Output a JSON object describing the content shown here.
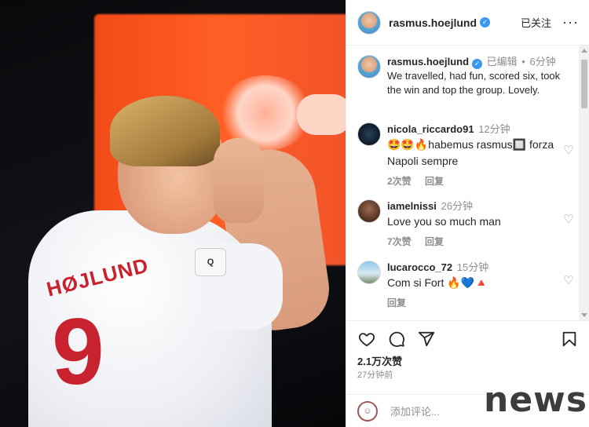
{
  "header": {
    "username": "rasmus.hoejlund",
    "follow_label": "已关注",
    "more_label": "···"
  },
  "post": {
    "username": "rasmus.hoejlund",
    "edited": "已编辑",
    "separator": "•",
    "time": "6分钟",
    "caption": "We travelled, had fun, scored six, took the win and top the group. Lovely."
  },
  "comments": [
    {
      "user": "nicola_riccardo91",
      "time": "12分钟",
      "text": "🤩🤩🔥habemus rasmus🔲 forza Napoli sempre",
      "likes": "2次赞",
      "reply": "回复"
    },
    {
      "user": "iamelnissi",
      "time": "26分钟",
      "text": "Love you so much man",
      "likes": "7次赞",
      "reply": "回复"
    },
    {
      "user": "lucarocco_72",
      "time": "15分钟",
      "text": "Com si Fort 🔥💙🔺",
      "likes": "",
      "reply": "回复"
    }
  ],
  "stats": {
    "likes": "2.1万次赞",
    "posted": "27分钟前"
  },
  "add_comment": {
    "placeholder": "添加评论..."
  },
  "photo": {
    "jersey_number": "9",
    "jersey_name": "HØJLUND",
    "badge": "Q"
  },
  "watermark": "news",
  "icons": {
    "like": "heart-icon",
    "comment": "comment-icon",
    "share": "send-icon",
    "save": "bookmark-icon",
    "verified": "verified-badge-icon",
    "emoji": "emoji-icon"
  },
  "colors": {
    "verified": "#3897f0",
    "muted_text": "#8e8e8e",
    "jersey_red": "#c8222e"
  }
}
